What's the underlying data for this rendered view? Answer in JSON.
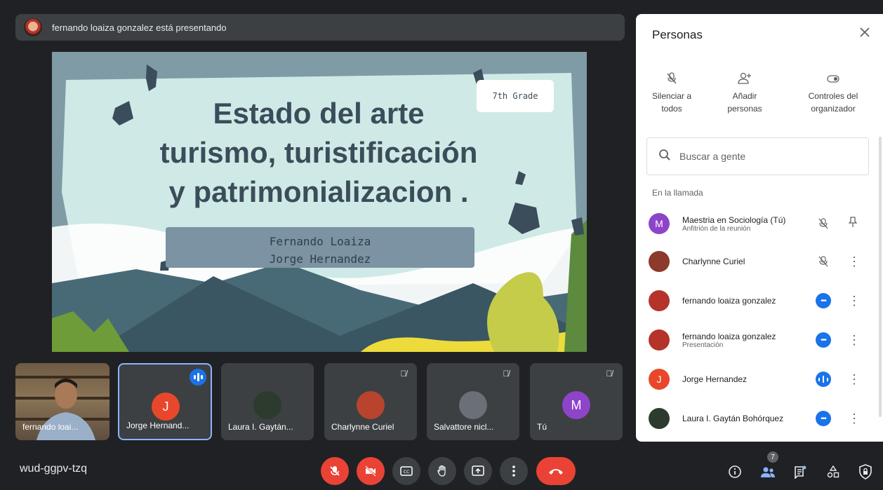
{
  "banner": {
    "text": "fernando loaiza gonzalez está presentando"
  },
  "slide": {
    "grade": "7th Grade",
    "title_lines": [
      "Estado del arte",
      "turismo, turistificación",
      "y patrimonializacion ."
    ],
    "authors": [
      "Fernando Loaiza",
      "Jorge Hernandez"
    ]
  },
  "tiles": [
    {
      "name": "fernando loai..."
    },
    {
      "name": "Jorge Hernand...",
      "initial": "J"
    },
    {
      "name": "Laura I. Gaytán..."
    },
    {
      "name": "Charlynne Curiel"
    },
    {
      "name": "Salvattore nicl..."
    },
    {
      "name": "Tú",
      "initial": "M"
    }
  ],
  "meeting_code": "wud-ggpv-tzq",
  "people_badge": "7",
  "colors": {
    "accent": "#1a73e8",
    "danger": "#ea4335",
    "panel_bg": "#ffffff",
    "bg": "#202124"
  },
  "panel": {
    "title": "Personas",
    "actions": [
      {
        "label1": "Silenciar a",
        "label2": "todos",
        "icon": "mic-off-icon"
      },
      {
        "label1": "Añadir",
        "label2": "personas",
        "icon": "add-person-icon"
      },
      {
        "label1": "Controles del",
        "label2": "organizador",
        "icon": "toggle-icon"
      }
    ],
    "search_placeholder": "Buscar a gente",
    "section": "En la llamada",
    "participants": [
      {
        "name": "Maestria en Sociología (Tú)",
        "sub": "Anfitrión de la reunión",
        "initial": "M"
      },
      {
        "name": "Charlynne Curiel",
        "sub": ""
      },
      {
        "name": "fernando loaiza gonzalez",
        "sub": ""
      },
      {
        "name": "fernando loaiza gonzalez",
        "sub": "Presentación"
      },
      {
        "name": "Jorge Hernandez",
        "sub": "",
        "initial": "J"
      },
      {
        "name": "Laura I. Gaytán Bohórquez",
        "sub": ""
      }
    ]
  }
}
